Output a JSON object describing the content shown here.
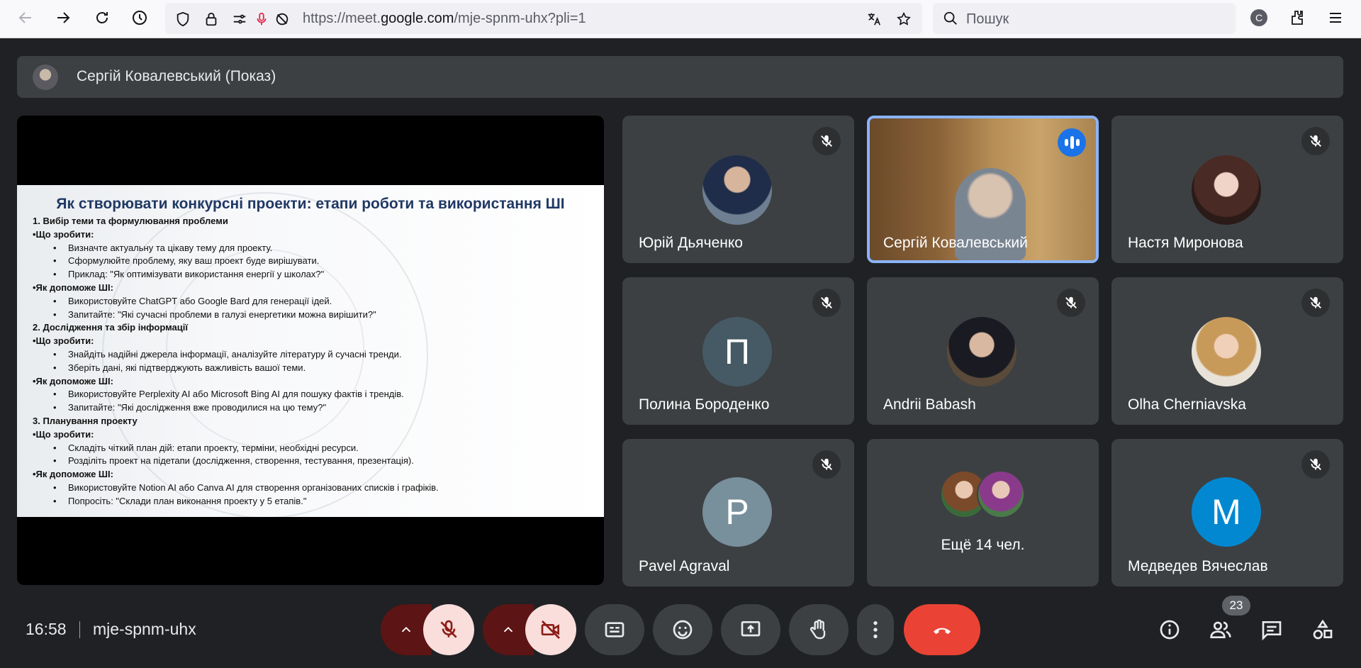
{
  "browser": {
    "url_prefix": "https://meet.",
    "url_domain": "google.com",
    "url_path": "/mje-spnm-uhx?pli=1",
    "search_placeholder": "Пошук",
    "profile_letter": "C"
  },
  "presenter": {
    "name": "Сергій Ковалевський (Показ)"
  },
  "slide": {
    "title": "Як створювати конкурсні проекти: етапи роботи та використання ШІ",
    "lines": [
      {
        "text": "1. Вибір теми та формулювання проблеми",
        "style": "b"
      },
      {
        "text": "•Що зробити:",
        "style": "b"
      },
      {
        "text": "Визначте актуальну та цікаву тему для проекту.",
        "style": "bl"
      },
      {
        "text": "Сформулюйте проблему, яку ваш проект буде вирішувати.",
        "style": "bl"
      },
      {
        "text": "Приклад: \"Як оптимізувати використання енергії у школах?\"",
        "style": "bl"
      },
      {
        "text": "•Як допоможе ШІ:",
        "style": "b"
      },
      {
        "text": "Використовуйте ChatGPT або Google Bard для генерації ідей.",
        "style": "bl"
      },
      {
        "text": "Запитайте: \"Які сучасні проблеми в галузі енергетики можна вирішити?\"",
        "style": "bl"
      },
      {
        "text": "2. Дослідження та збір інформації",
        "style": "b"
      },
      {
        "text": "•Що зробити:",
        "style": "b"
      },
      {
        "text": "Знайдіть надійні джерела інформації, аналізуйте літературу й сучасні тренди.",
        "style": "bl"
      },
      {
        "text": "Зберіть дані, які підтверджують важливість вашої теми.",
        "style": "bl"
      },
      {
        "text": "•Як допоможе ШІ:",
        "style": "b"
      },
      {
        "text": "Використовуйте Perplexity AI або Microsoft Bing AI для пошуку фактів і трендів.",
        "style": "bl"
      },
      {
        "text": "Запитайте: \"Які дослідження вже проводилися на цю тему?\"",
        "style": "bl"
      },
      {
        "text": "3. Планування проекту",
        "style": "b"
      },
      {
        "text": "•Що зробити:",
        "style": "b"
      },
      {
        "text": "Складіть чіткий план дій: етапи проекту, терміни, необхідні ресурси.",
        "style": "bl"
      },
      {
        "text": "Розділіть проект на підетапи (дослідження, створення, тестування, презентація).",
        "style": "bl"
      },
      {
        "text": "•Як допоможе ШІ:",
        "style": "b"
      },
      {
        "text": "Використовуйте Notion AI або Canva AI для створення організованих списків і графіків.",
        "style": "bl"
      },
      {
        "text": "Попросіть: \"Склади план виконання проекту у 5 етапів.\"",
        "style": "bl"
      }
    ]
  },
  "participants": [
    {
      "name": "Юрій Дьяченко",
      "avatar": "photo",
      "muted": true
    },
    {
      "name": "Сергій Ковалевський",
      "avatar": "video",
      "muted": false,
      "speaking": true
    },
    {
      "name": "Настя Миронова",
      "avatar": "photo",
      "muted": true
    },
    {
      "name": "Полина Бороденко",
      "avatar_letter": "П",
      "avatar_color": "#455a64",
      "muted": true
    },
    {
      "name": "Andrii Babash",
      "avatar": "photo",
      "muted": true
    },
    {
      "name": "Olha Cherniavska",
      "avatar": "photo",
      "muted": true
    },
    {
      "name": "Pavel Agraval",
      "avatar_letter": "P",
      "avatar_color": "#78909c",
      "muted": true
    },
    {
      "name": "Ещё 14 чел.",
      "avatar": "group"
    },
    {
      "name": "Медведев Вячеслав",
      "avatar_letter": "M",
      "avatar_color": "#0288d1",
      "muted": true
    }
  ],
  "footer": {
    "time": "16:58",
    "meeting_code": "mje-spnm-uhx",
    "participant_count": "23"
  },
  "colors": {
    "background": "#202124",
    "tile": "#3c4043",
    "active_border": "#8ab4f8",
    "hangup": "#ea4335",
    "muted_control": "#f9dedc"
  },
  "icons": [
    "back-icon",
    "forward-icon",
    "reload-icon",
    "history-icon",
    "shield-icon",
    "lock-icon",
    "permissions-icon",
    "mic-icon",
    "camera-off-icon",
    "translate-icon",
    "star-icon",
    "search-icon",
    "extensions-icon",
    "menu-icon",
    "mic-off-icon",
    "chevron-up-icon",
    "camera-off-icon",
    "captions-icon",
    "emoji-icon",
    "present-icon",
    "raise-hand-icon",
    "more-icon",
    "hangup-icon",
    "info-icon",
    "people-icon",
    "chat-icon",
    "activities-icon"
  ]
}
